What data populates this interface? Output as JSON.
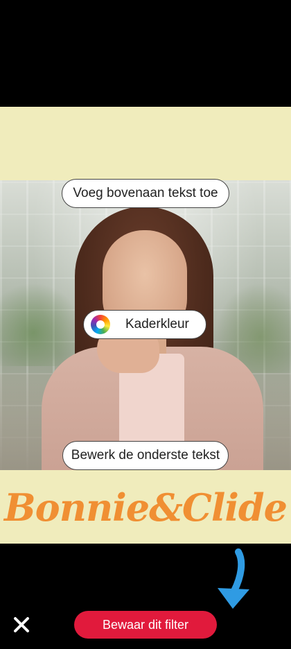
{
  "editor": {
    "add_top_text": "Voeg bovenaan tekst toe",
    "frame_color": "Kaderkleur",
    "edit_bottom_text": "Bewerk de onderste tekst",
    "bottom_text": "Bonnie&Clide",
    "frame_color_value": "#f0ecbc",
    "bottom_text_color": "#f08f33"
  },
  "footer": {
    "close_icon": "close-icon",
    "save_label": "Bewaar dit filter",
    "save_color": "#e11a3c"
  },
  "hint": {
    "arrow_icon": "arrow-down-icon",
    "arrow_color": "#2f9be3"
  }
}
